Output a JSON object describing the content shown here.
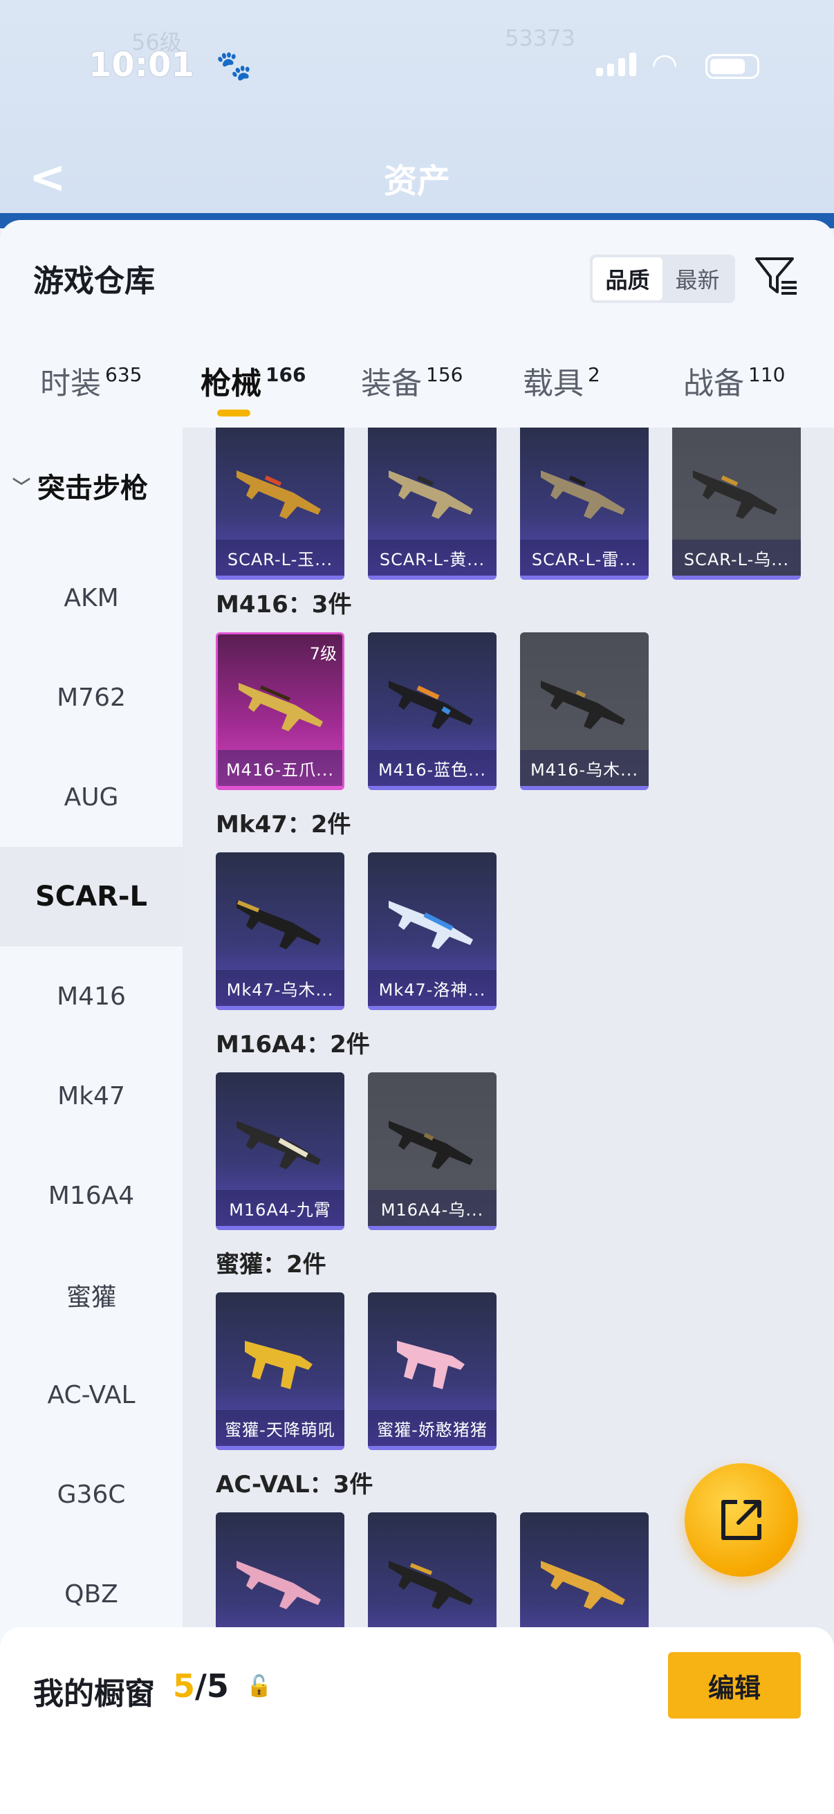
{
  "status_bar": {
    "time": "10:01"
  },
  "header": {
    "back_label": "<",
    "title": "资产"
  },
  "warehouse": {
    "title": "游戏仓库",
    "sort_options": [
      "品质",
      "最新"
    ],
    "sort_selected": "品质",
    "filter_icon": "filter-icon"
  },
  "tabs": [
    {
      "label": "时装",
      "count": "635"
    },
    {
      "label": "枪械",
      "count": "166"
    },
    {
      "label": "装备",
      "count": "156"
    },
    {
      "label": "载具",
      "count": "2"
    },
    {
      "label": "战备",
      "count": "110"
    }
  ],
  "active_tab": "枪械",
  "sidebar": {
    "group": "突击步枪",
    "items": [
      "AKM",
      "M762",
      "AUG",
      "SCAR-L",
      "M416",
      "Mk47",
      "M16A4",
      "蜜獾",
      "AC-VAL",
      "G36C",
      "QBZ"
    ],
    "selected": "SCAR-L"
  },
  "groups": [
    {
      "label": "",
      "items": [
        {
          "name": "SCAR-L-玉...",
          "style": "purple"
        },
        {
          "name": "SCAR-L-黄...",
          "style": "purple"
        },
        {
          "name": "SCAR-L-雷...",
          "style": "purple"
        },
        {
          "name": "SCAR-L-乌...",
          "style": "gray"
        }
      ]
    },
    {
      "label": "M416：3件",
      "items": [
        {
          "name": "M416-五爪...",
          "style": "pink",
          "level": "7级"
        },
        {
          "name": "M416-蓝色...",
          "style": "purple"
        },
        {
          "name": "M416-乌木...",
          "style": "gray"
        }
      ]
    },
    {
      "label": "Mk47：2件",
      "items": [
        {
          "name": "Mk47-乌木...",
          "style": "purple"
        },
        {
          "name": "Mk47-洛神...",
          "style": "purple"
        }
      ]
    },
    {
      "label": "M16A4：2件",
      "items": [
        {
          "name": "M16A4-九霄",
          "style": "purple"
        },
        {
          "name": "M16A4-乌...",
          "style": "gray"
        }
      ]
    },
    {
      "label": "蜜獾：2件",
      "items": [
        {
          "name": "蜜獾-天降萌吼",
          "style": "purple"
        },
        {
          "name": "蜜獾-娇憨猪猪",
          "style": "purple"
        }
      ]
    },
    {
      "label": "AC-VAL：3件",
      "items": [
        {
          "name": "",
          "style": "purple"
        },
        {
          "name": "",
          "style": "purple"
        },
        {
          "name": "",
          "style": "purple"
        }
      ]
    }
  ],
  "bottom_bar": {
    "label": "我的橱窗",
    "count_current": "5",
    "count_separator": "/",
    "count_total": "5",
    "edit_label": "编辑"
  },
  "colors": {
    "accent": "#f5b400",
    "card_purple": "#3a3a78",
    "card_gray": "#555761",
    "card_pink": "#a12c93",
    "card_underline": "#7d73ea"
  }
}
